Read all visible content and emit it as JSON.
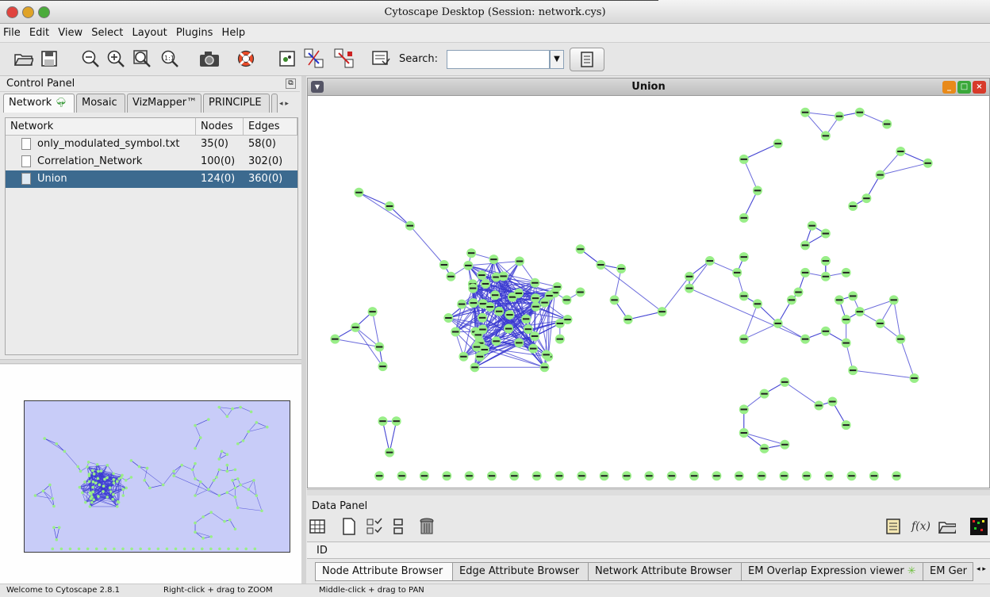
{
  "window": {
    "title": "Cytoscape Desktop (Session: network.cys)"
  },
  "menu": [
    "File",
    "Edit",
    "View",
    "Select",
    "Layout",
    "Plugins",
    "Help"
  ],
  "toolbar": {
    "icons": [
      "open-icon",
      "save-icon",
      "zoom-out-icon",
      "zoom-in-icon",
      "zoom-selected-icon",
      "zoom-fit-icon",
      "camera-icon",
      "help-lifebuoy-icon",
      "new-network-icon",
      "first-neighbors-icon",
      "hide-edges-icon",
      "select-from-file-icon"
    ],
    "search_label": "Search:",
    "search_value": ""
  },
  "control_panel": {
    "title": "Control Panel",
    "tabs": [
      "Network",
      "Mosaic",
      "VizMapper™",
      "PRINCIPLE"
    ],
    "active_tab": "Network",
    "table": {
      "headers": [
        "Network",
        "Nodes",
        "Edges"
      ],
      "rows": [
        {
          "name": "only_modulated_symbol.txt",
          "nodes": "35(0)",
          "edges": "58(0)",
          "selected": false
        },
        {
          "name": "Correlation_Network",
          "nodes": "100(0)",
          "edges": "302(0)",
          "selected": false
        },
        {
          "name": "Union",
          "nodes": "124(0)",
          "edges": "360(0)",
          "selected": true
        }
      ]
    }
  },
  "network_view": {
    "title": "Union",
    "node_color": "#99ee88",
    "edge_color": "#3a3ad0"
  },
  "data_panel": {
    "title": "Data Panel",
    "column_header": "ID",
    "fx_label": "f(x)",
    "tabs": [
      "Node Attribute Browser",
      "Edge Attribute Browser",
      "Network Attribute Browser",
      "EM Overlap Expression viewer",
      "EM Ger"
    ],
    "active_tab": "Node Attribute Browser"
  },
  "status": {
    "welcome": "Welcome to Cytoscape 2.8.1",
    "zoom_hint": "Right-click + drag to ZOOM",
    "pan_hint": "Middle-click + drag to PAN"
  }
}
